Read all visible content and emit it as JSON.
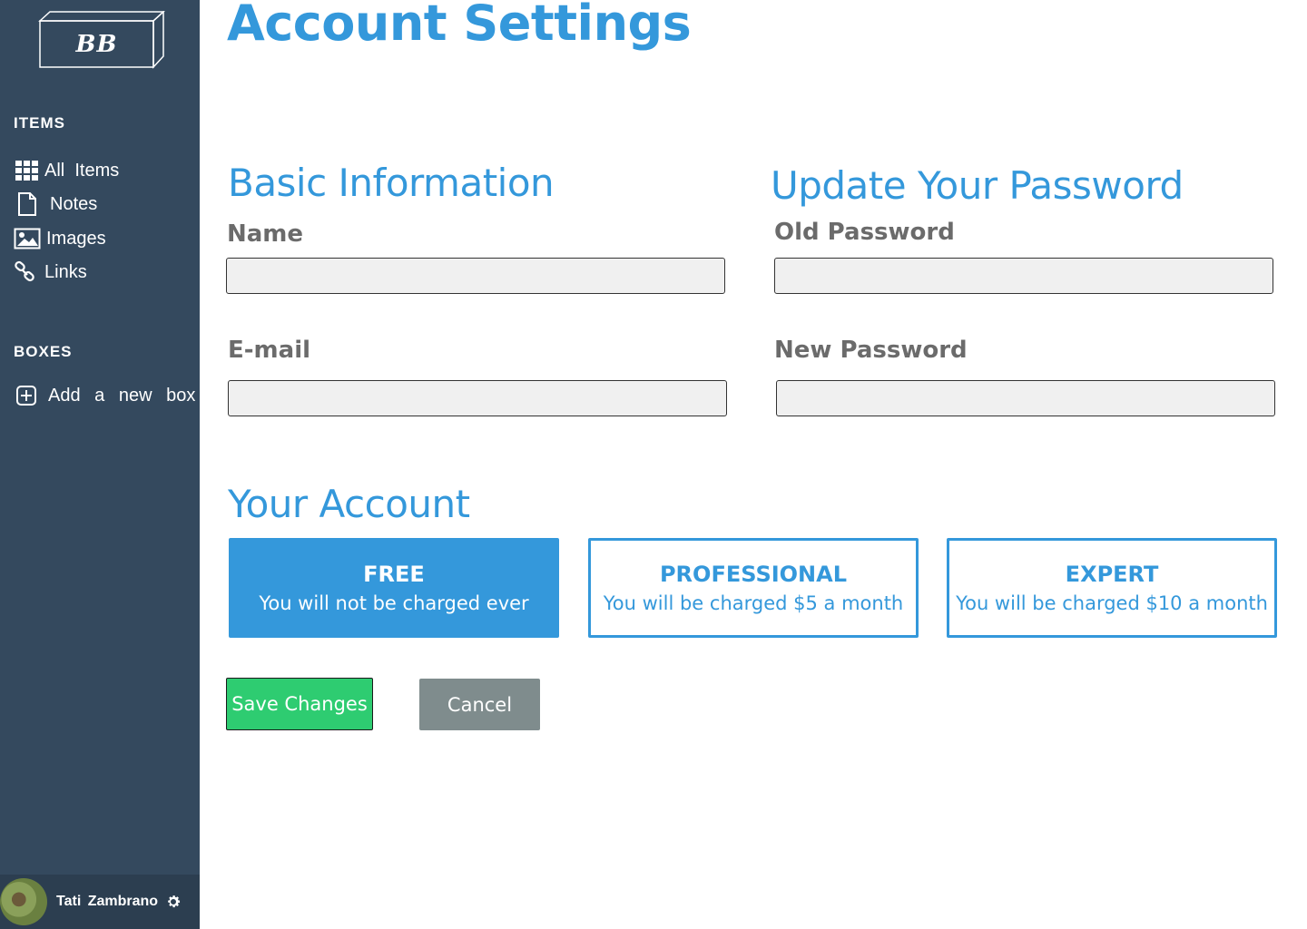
{
  "sidebar": {
    "logo_text": "BB",
    "items_title": "ITEMS",
    "items": [
      {
        "label": "All  Items",
        "icon": "grid-icon"
      },
      {
        "label": "Notes",
        "icon": "file-icon"
      },
      {
        "label": "Images",
        "icon": "image-icon"
      },
      {
        "label": "Links",
        "icon": "link-icon"
      }
    ],
    "boxes_title": "BOXES",
    "add_box_label": "Add a new box",
    "user_name": "Tati Zambrano"
  },
  "main": {
    "title": "Account Settings",
    "basic": {
      "heading": "Basic Information",
      "name_label": "Name",
      "name_value": "",
      "email_label": "E-mail",
      "email_value": ""
    },
    "password": {
      "heading": "Update Your Password",
      "old_label": "Old Password",
      "old_value": "",
      "new_label": "New Password",
      "new_value": ""
    },
    "account": {
      "heading": "Your Account",
      "plans": [
        {
          "name": "FREE",
          "desc": "You will not be charged ever",
          "selected": true
        },
        {
          "name": "PROFESSIONAL",
          "desc": "You will be charged $5 a month",
          "selected": false
        },
        {
          "name": "EXPERT",
          "desc": "You will be charged $10 a month",
          "selected": false
        }
      ]
    },
    "save_label": "Save Changes",
    "cancel_label": "Cancel"
  },
  "colors": {
    "sidebar_bg": "#34495e",
    "user_bar_bg": "#2c3e50",
    "accent": "#3498db",
    "save": "#2ecc71",
    "cancel": "#7f8c8d"
  }
}
